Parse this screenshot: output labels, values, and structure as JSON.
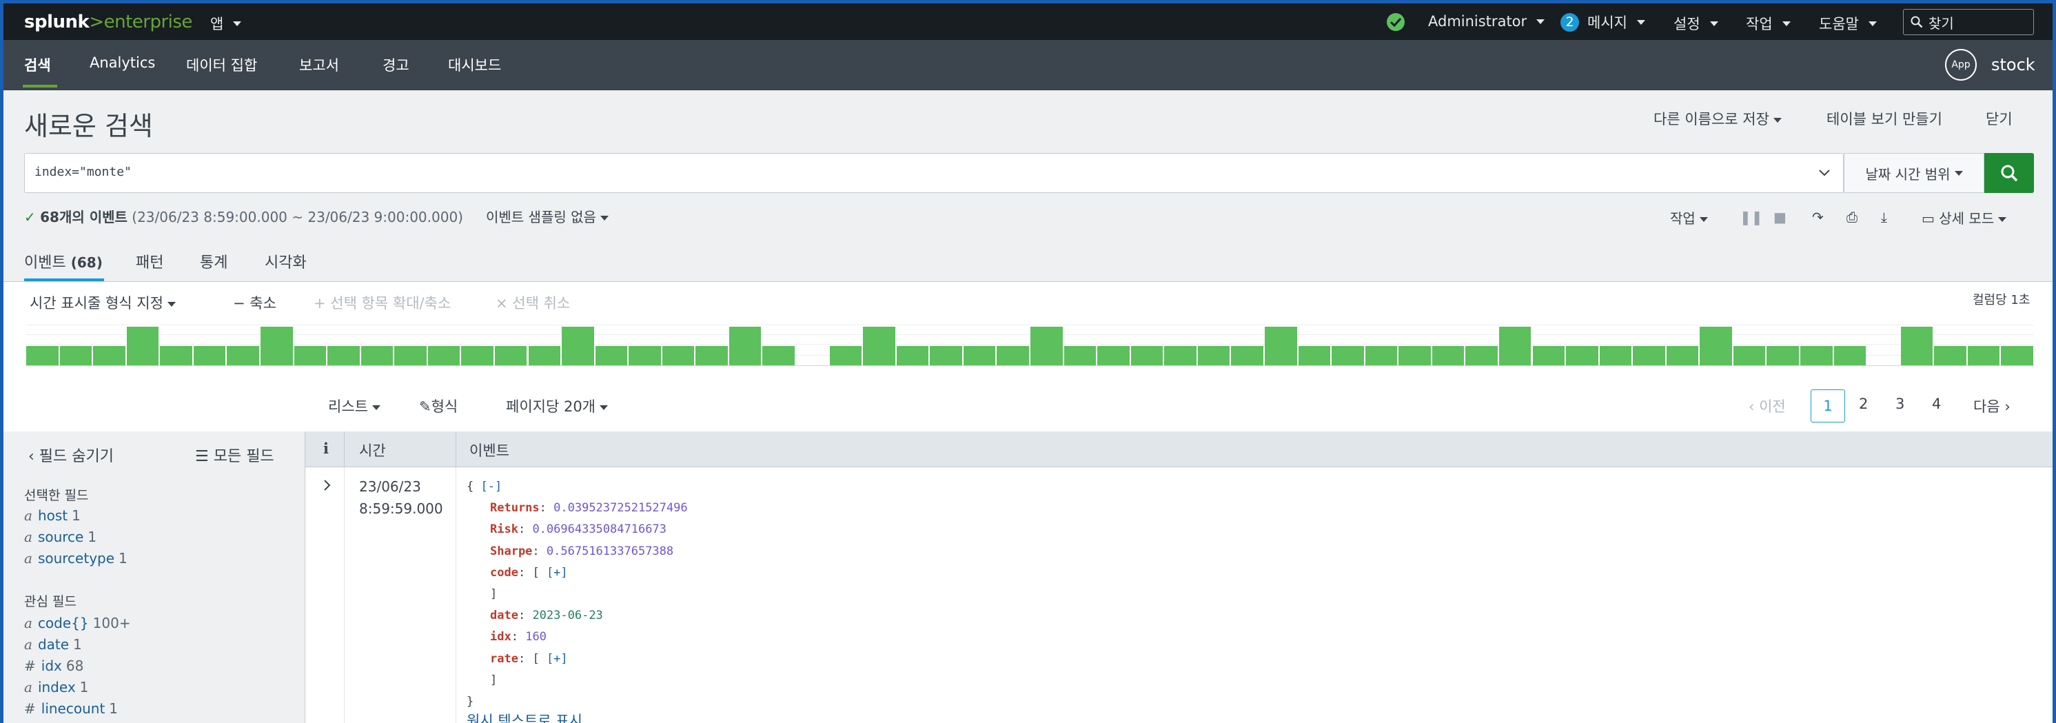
{
  "topbar": {
    "logo_left": "splunk",
    "logo_gt": ">",
    "logo_right": "enterprise",
    "apps_label": "앱",
    "user_label": "Administrator",
    "messages_count": "2",
    "messages_label": "메시지",
    "settings_label": "설정",
    "activity_label": "작업",
    "help_label": "도움말",
    "find_placeholder": "찾기"
  },
  "appbar": {
    "nav": [
      "검색",
      "Analytics",
      "데이터 집합",
      "보고서",
      "경고",
      "대시보드"
    ],
    "app_icon_label": "App",
    "app_name": "stock"
  },
  "search": {
    "title": "새로운 검색",
    "save_as": "다른 이름으로 저장",
    "create_table_view": "테이블 보기 만들기",
    "close": "닫기",
    "query": "index=\"monte\"",
    "time_range": "날짜 시간 범위",
    "status_count": "68개의 이벤트",
    "status_range": "(23/06/23 8:59:00.000 ~ 23/06/23 9:00:00.000)",
    "sampling": "이벤트 샘플링 없음",
    "job_label": "작업",
    "mode_label": "상세 모드"
  },
  "tabs": {
    "events_label": "이벤트",
    "events_count": "(68)",
    "patterns": "패턴",
    "statistics": "통계",
    "visualization": "시각화"
  },
  "timeline": {
    "format": "시간 표시줄 형식 지정",
    "zoom_out": "축소",
    "zoom_selection": "선택 항목 확대/축소",
    "deselect": "선택 취소",
    "scale": "컬럼당 1초",
    "column_counts": [
      1,
      1,
      1,
      2,
      1,
      1,
      1,
      2,
      1,
      1,
      1,
      1,
      1,
      1,
      1,
      1,
      2,
      1,
      1,
      1,
      1,
      2,
      1,
      0,
      1,
      2,
      1,
      1,
      1,
      1,
      2,
      1,
      1,
      1,
      1,
      1,
      1,
      2,
      1,
      1,
      1,
      1,
      1,
      1,
      2,
      1,
      1,
      1,
      1,
      1,
      2,
      1,
      1,
      1,
      1,
      0,
      2,
      1,
      1,
      1
    ]
  },
  "results": {
    "list_label": "리스트",
    "format_label": "형식",
    "per_page": "페이지당 20개",
    "prev": "이전",
    "pages": [
      "1",
      "2",
      "3",
      "4"
    ],
    "next": "다음"
  },
  "sidebar": {
    "hide_fields": "필드 숨기기",
    "all_fields": "모든 필드",
    "selected_title": "선택한 필드",
    "selected": [
      {
        "type": "a",
        "name": "host",
        "count": "1"
      },
      {
        "type": "a",
        "name": "source",
        "count": "1"
      },
      {
        "type": "a",
        "name": "sourcetype",
        "count": "1"
      }
    ],
    "interesting_title": "관심 필드",
    "interesting": [
      {
        "type": "a",
        "name": "code{}",
        "count": "100+"
      },
      {
        "type": "a",
        "name": "date",
        "count": "1"
      },
      {
        "type": "#",
        "name": "idx",
        "count": "68"
      },
      {
        "type": "a",
        "name": "index",
        "count": "1"
      },
      {
        "type": "#",
        "name": "linecount",
        "count": "1"
      }
    ]
  },
  "table": {
    "col_i": "i",
    "col_time": "시간",
    "col_event": "이벤트",
    "row_date": "23/06/23",
    "row_time": "8:59:59.000",
    "event": {
      "open": "{",
      "collapse": "[-]",
      "returns_key": "Returns",
      "returns_val": "0.03952372521527496",
      "risk_key": "Risk",
      "risk_val": "0.06964335084716673",
      "sharpe_key": "Sharpe",
      "sharpe_val": "0.5675161337657388",
      "code_key": "code",
      "code_open": "[",
      "expand": "[+]",
      "close_bracket": "]",
      "date_key": "date",
      "date_val": "2023-06-23",
      "idx_key": "idx",
      "idx_val": "160",
      "rate_key": "rate",
      "close": "}"
    },
    "raw_text": "원시 텍스트로 표시"
  },
  "colors": {
    "topbar": "#171d21",
    "appbar": "#3c444d",
    "accent_green": "#65a637",
    "search_button": "#1e8a32",
    "bar_green": "#5cc05c",
    "link_blue": "#1a9bd7"
  }
}
